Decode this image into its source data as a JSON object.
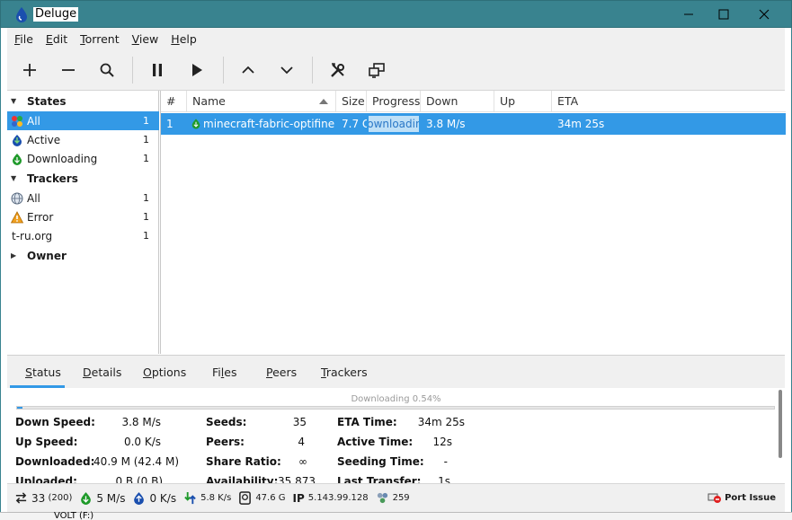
{
  "window": {
    "title": "Deluge",
    "colors": {
      "titlebar": "#39838f",
      "selection": "#3399e6"
    }
  },
  "menu": [
    {
      "label": "File",
      "u": "F",
      "rest": "ile"
    },
    {
      "label": "Edit",
      "u": "E",
      "rest": "dit"
    },
    {
      "label": "Torrent",
      "u": "T",
      "rest": "orrent"
    },
    {
      "label": "View",
      "u": "V",
      "rest": "iew"
    },
    {
      "label": "Help",
      "u": "H",
      "rest": "elp"
    }
  ],
  "toolbar": {
    "icons": [
      "add-icon",
      "remove-icon",
      "search-icon",
      "pause-icon",
      "resume-icon",
      "queue-up-icon",
      "queue-down-icon",
      "preferences-icon",
      "connection-manager-icon"
    ]
  },
  "sidebar": {
    "states_header": "States",
    "states": [
      {
        "label": "All",
        "count": "1",
        "icon": "all-states-icon"
      },
      {
        "label": "Active",
        "count": "1",
        "icon": "active-icon"
      },
      {
        "label": "Downloading",
        "count": "1",
        "icon": "downloading-icon"
      }
    ],
    "trackers_header": "Trackers",
    "trackers": [
      {
        "label": "All",
        "count": "1",
        "icon": "globe-icon"
      },
      {
        "label": "Error",
        "count": "1",
        "icon": "warning-icon"
      },
      {
        "label": "t-ru.org",
        "count": "1",
        "icon": ""
      }
    ],
    "owner_header": "Owner"
  },
  "torrents": {
    "columns": [
      "#",
      "Name",
      "Size",
      "Progress",
      "Down Speed",
      "Up Speed",
      "ETA"
    ],
    "rows": [
      {
        "index": "1",
        "name": "minecraft-fabric-optifine",
        "size": "7.7 G",
        "progress_text": "Downloading",
        "progress_fraction": 0.0054,
        "down_speed": "3.8 M/s",
        "up_speed": "",
        "eta": "34m 25s"
      }
    ]
  },
  "tabs": [
    {
      "u": "S",
      "rest": "tatus"
    },
    {
      "u": "D",
      "rest": "etails"
    },
    {
      "u": "O",
      "rest": "ptions"
    },
    {
      "pre": "Fi",
      "u": "l",
      "rest": "es"
    },
    {
      "u": "P",
      "rest": "eers"
    },
    {
      "u": "T",
      "rest": "rackers"
    }
  ],
  "status": {
    "progress_label": "Downloading 0.54%",
    "progress_fraction": 0.0054,
    "col1": [
      {
        "k": "Down Speed:",
        "v": "3.8 M/s"
      },
      {
        "k": "Up Speed:",
        "v": "0.0 K/s"
      },
      {
        "k": "Downloaded:",
        "v": "40.9 M (42.4 M)"
      },
      {
        "k": "Uploaded:",
        "v": "0 B (0 B)"
      }
    ],
    "col2": [
      {
        "k": "Seeds:",
        "v": "35"
      },
      {
        "k": "Peers:",
        "v": "4"
      },
      {
        "k": "Share Ratio:",
        "v": "∞"
      },
      {
        "k": "Availability:",
        "v": "35.873"
      }
    ],
    "col3": [
      {
        "k": "ETA Time:",
        "v": "34m 25s"
      },
      {
        "k": "Active Time:",
        "v": "12s"
      },
      {
        "k": "Seeding Time:",
        "v": "-"
      },
      {
        "k": "Last Transfer:",
        "v": "1s"
      }
    ]
  },
  "statusbar": {
    "connections": "33",
    "connections_max": "(200)",
    "down": "5 M/s",
    "up": "0 K/s",
    "protocol": "5.8 K/s",
    "disk": "47.6 G",
    "ip_label": "IP",
    "ip": "5.143.99.128",
    "dht": "259",
    "port": "Port Issue"
  },
  "behind": {
    "label": "VOLT (F:)"
  }
}
